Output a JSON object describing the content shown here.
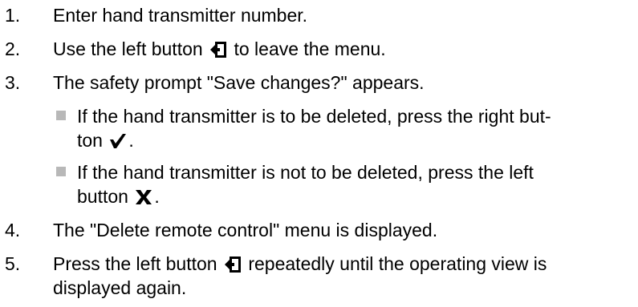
{
  "steps": [
    {
      "num": "1.",
      "text": "Enter hand transmitter number."
    },
    {
      "num": "2.",
      "before": "Use the left button",
      "icon": "back-arrow-icon",
      "after": " to leave the menu."
    },
    {
      "num": "3.",
      "text": "The safety prompt \"Save changes?\" appears."
    },
    {
      "num": "4.",
      "text": "The \"Delete remote control\" menu is displayed."
    },
    {
      "num": "5.",
      "before": "Press the left button",
      "icon": "back-arrow-icon",
      "after": " repeatedly until the operating view is",
      "line2": "displayed again."
    }
  ],
  "substeps": [
    {
      "line1": "If the hand transmitter is to be deleted, press the right but-",
      "line2_before": "ton",
      "icon": "checkmark-icon",
      "line2_after": "."
    },
    {
      "line1": "If the hand transmitter is not to be deleted, press the left",
      "line2_before": "button",
      "icon": "cross-icon",
      "line2_after": "."
    }
  ]
}
